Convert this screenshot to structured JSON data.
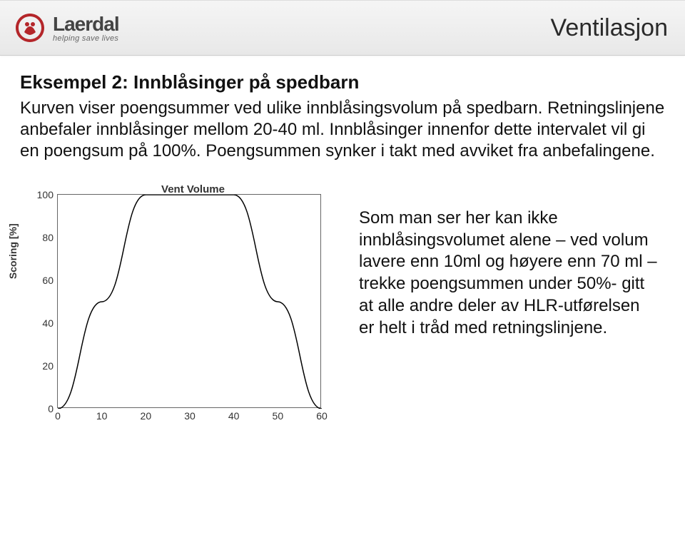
{
  "header": {
    "brand": "Laerdal",
    "tagline": "helping save lives",
    "page_title": "Ventilasjon"
  },
  "main": {
    "heading": "Eksempel 2: Innblåsinger på spedbarn",
    "body": "Kurven viser poengsummer ved ulike innblåsingsvolum på spedbarn. Retningslinjene anbefaler innblåsinger mellom 20-40 ml. Innblåsinger innenfor dette intervalet vil gi en poengsum på 100%. Poengsummen synker i takt med avviket fra anbefalingene.",
    "side_note": "Som man ser her kan ikke innblåsingsvolumet alene – ved volum lavere enn 10ml og høyere enn 70 ml – trekke poengsummen under 50%- gitt at alle andre deler av HLR-utførelsen er helt i tråd med retningslinjene."
  },
  "chart_data": {
    "type": "line",
    "title": "Vent Volume",
    "ylabel": "Scoring [%]",
    "xlabel": "",
    "xlim": [
      0,
      60
    ],
    "ylim": [
      0,
      100
    ],
    "xticks": [
      0,
      10,
      20,
      30,
      40,
      50,
      60
    ],
    "yticks": [
      0,
      20,
      40,
      60,
      80,
      100
    ],
    "x": [
      0,
      10,
      20,
      40,
      50,
      60
    ],
    "y": [
      0,
      50,
      100,
      100,
      50,
      0
    ]
  }
}
